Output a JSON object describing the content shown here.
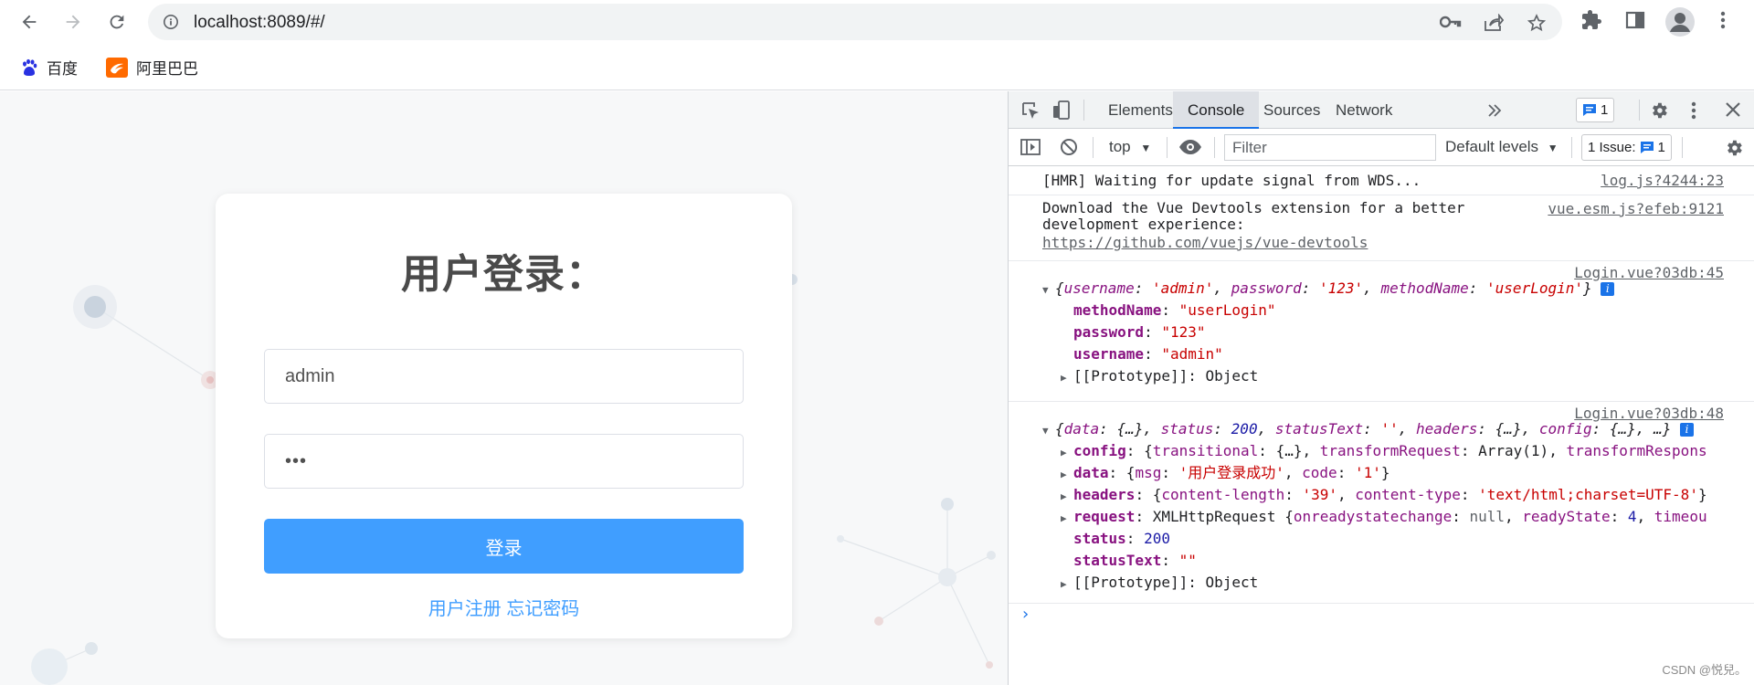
{
  "browser": {
    "url": "localhost:8089/#/",
    "bookmarks": [
      {
        "label": "百度",
        "icon": "baidu-paw-icon"
      },
      {
        "label": "阿里巴巴",
        "icon": "alibaba-logo-icon"
      }
    ]
  },
  "login": {
    "title": "用户登录：",
    "username_value": "admin",
    "password_value": "•••",
    "submit_label": "登录",
    "register_link": "用户注册",
    "forgot_link": "忘记密码"
  },
  "devtools": {
    "tabs": [
      "Elements",
      "Console",
      "Sources",
      "Network"
    ],
    "active_tab": "Console",
    "message_badge": "1",
    "context": "top",
    "filter_placeholder": "Filter",
    "levels": "Default levels",
    "issues_label": "1 Issue:",
    "issues_count": "1",
    "messages": [
      {
        "text": "[HMR] Waiting for update signal from WDS...",
        "source": "log.js?4244:23"
      },
      {
        "text": "Download the Vue Devtools extension for a better\ndevelopment experience:",
        "link": "https://github.com/vuejs/vue-devtools",
        "source": "vue.esm.js?efeb:9121"
      },
      {
        "source": "Login.vue?03db:45"
      },
      {
        "source": "Login.vue?03db:48"
      }
    ]
  },
  "watermark": "CSDN @悦兒。",
  "colors": {
    "accent": "#409eff",
    "devtools_blue": "#1a73e8"
  }
}
